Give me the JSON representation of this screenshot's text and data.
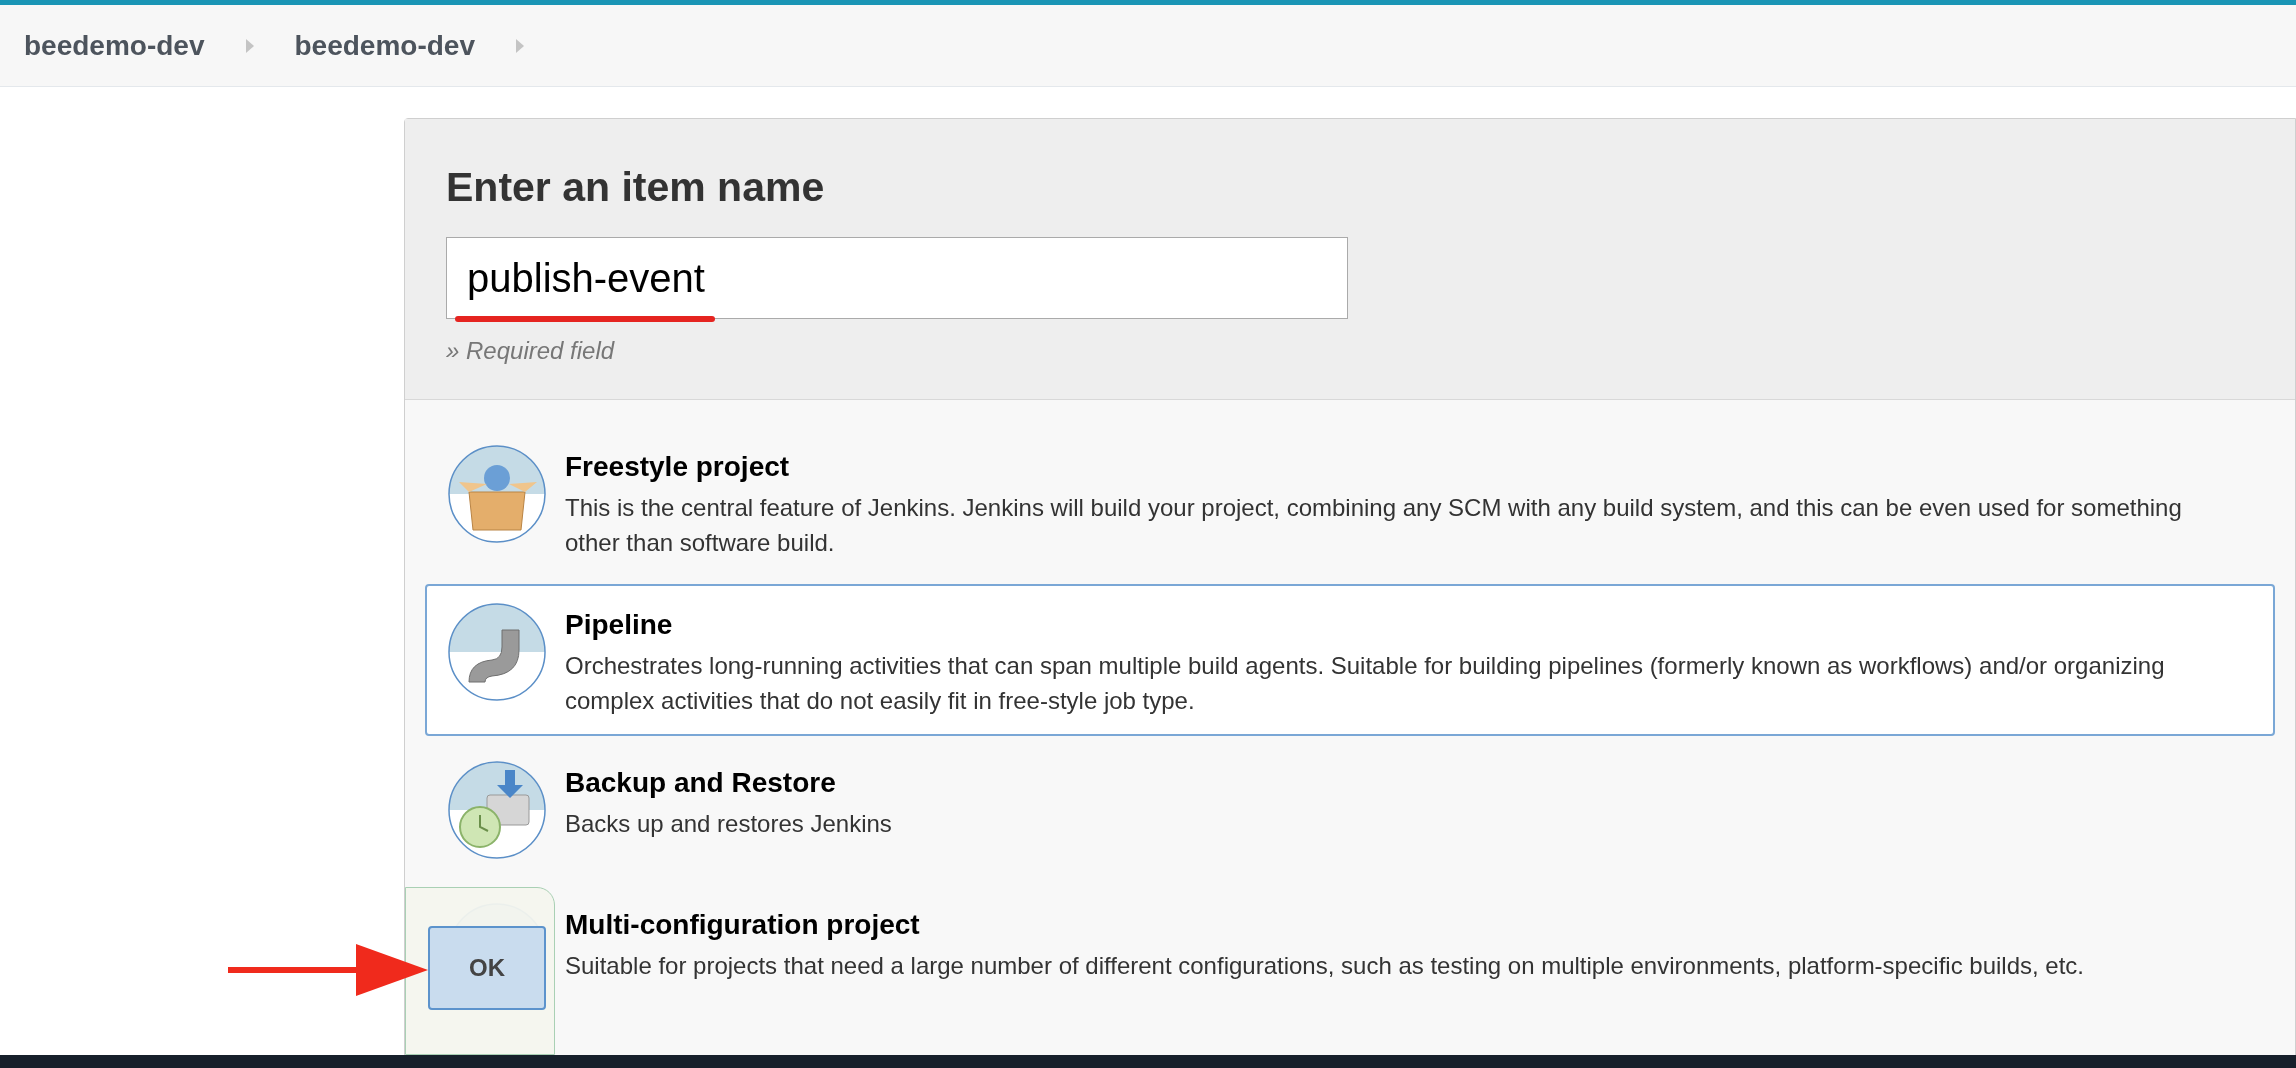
{
  "breadcrumbs": [
    {
      "label": "beedemo-dev"
    },
    {
      "label": "beedemo-dev"
    }
  ],
  "name_section": {
    "title": "Enter an item name",
    "input": {
      "value": "publish-event"
    },
    "hint": "» Required field"
  },
  "item_types": [
    {
      "kind": "freestyle",
      "title": "Freestyle project",
      "description": "This is the central feature of Jenkins. Jenkins will build your project, combining any SCM with any build system, and this can be even used for something other than software build.",
      "selected": false
    },
    {
      "kind": "pipeline",
      "title": "Pipeline",
      "description": "Orchestrates long-running activities that can span multiple build agents. Suitable for building pipelines (formerly known as workflows) and/or organizing complex activities that do not easily fit in free-style job type.",
      "selected": true
    },
    {
      "kind": "backup",
      "title": "Backup and Restore",
      "description": "Backs up and restores Jenkins",
      "selected": false
    },
    {
      "kind": "multi",
      "title": "Multi-configuration project",
      "description": "Suitable for projects that need a large number of different configurations, such as testing on multiple environments, platform-specific builds, etc.",
      "selected": false
    }
  ],
  "ok_button": {
    "label": "OK"
  }
}
